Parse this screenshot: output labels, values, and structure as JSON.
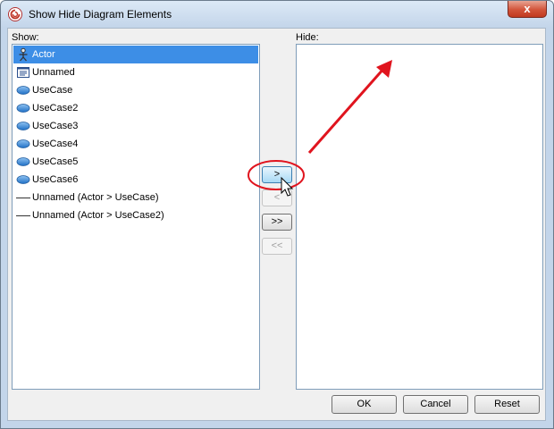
{
  "window": {
    "title": "Show Hide Diagram Elements",
    "close_label": "x"
  },
  "show_pane": {
    "label": "Show:",
    "items": [
      {
        "label": "Actor",
        "icon": "actor-icon",
        "selected": true
      },
      {
        "label": "Unnamed",
        "icon": "note-icon",
        "selected": false
      },
      {
        "label": "UseCase",
        "icon": "usecase-icon",
        "selected": false
      },
      {
        "label": "UseCase2",
        "icon": "usecase-icon",
        "selected": false
      },
      {
        "label": "UseCase3",
        "icon": "usecase-icon",
        "selected": false
      },
      {
        "label": "UseCase4",
        "icon": "usecase-icon",
        "selected": false
      },
      {
        "label": "UseCase5",
        "icon": "usecase-icon",
        "selected": false
      },
      {
        "label": "UseCase6",
        "icon": "usecase-icon",
        "selected": false
      },
      {
        "label": "Unnamed (Actor > UseCase)",
        "icon": "association-icon",
        "selected": false
      },
      {
        "label": "Unnamed (Actor > UseCase2)",
        "icon": "association-icon",
        "selected": false
      }
    ]
  },
  "hide_pane": {
    "label": "Hide:",
    "items": []
  },
  "transfer_buttons": {
    "move_right": ">",
    "move_left": "<",
    "move_all_right": ">>",
    "move_all_left": "<<"
  },
  "footer": {
    "ok": "OK",
    "cancel": "Cancel",
    "reset": "Reset"
  },
  "colors": {
    "selection": "#3d8ee6",
    "annotation": "#e0141e"
  }
}
